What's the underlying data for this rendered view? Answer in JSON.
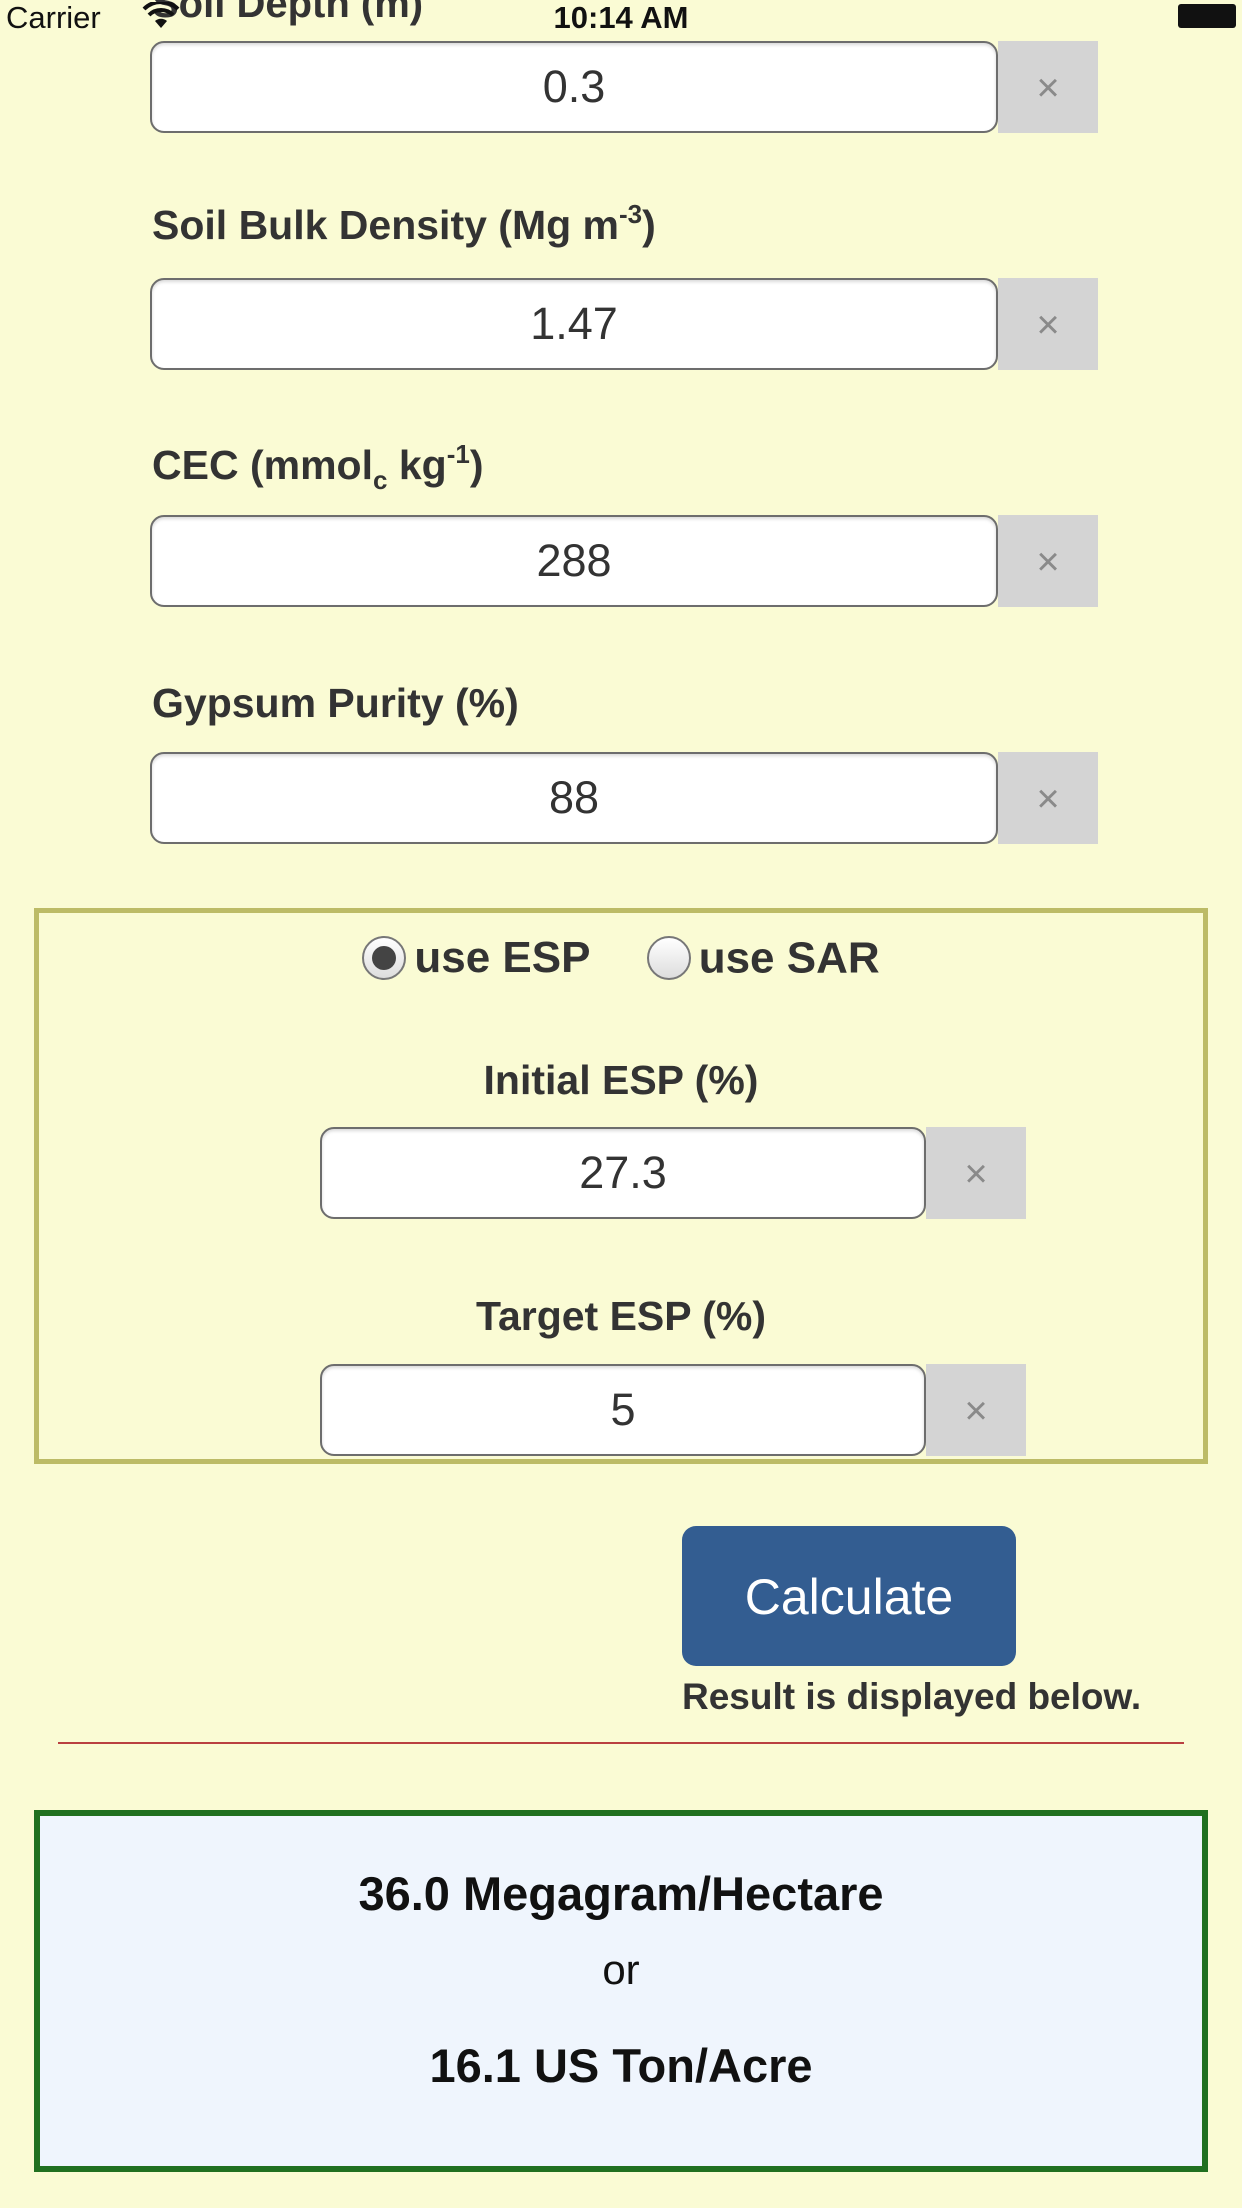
{
  "status_bar": {
    "carrier": "Carrier",
    "time": "10:14 AM"
  },
  "fields": {
    "soil_depth": {
      "label": "Soil Depth (m)",
      "value": "0.3",
      "clear_label": "×"
    },
    "bulk_density": {
      "label_main": "Soil Bulk Density (Mg m",
      "label_sup": "-3",
      "label_end": ")",
      "value": "1.47",
      "clear_label": "×"
    },
    "cec": {
      "label_main": "CEC (mmol",
      "label_sub": "c",
      "label_mid": " kg",
      "label_sup": "-1",
      "label_end": ")",
      "value": "288",
      "clear_label": "×"
    },
    "gypsum_purity": {
      "label": "Gypsum Purity (%)",
      "value": "88",
      "clear_label": "×"
    }
  },
  "mode": {
    "options": [
      {
        "label": "use ESP",
        "selected": true
      },
      {
        "label": "use SAR",
        "selected": false
      }
    ],
    "initial_esp": {
      "label": "Initial ESP (%)",
      "value": "27.3",
      "clear_label": "×"
    },
    "target_esp": {
      "label": "Target ESP (%)",
      "value": "5",
      "clear_label": "×"
    }
  },
  "calculate": {
    "label": "Calculate",
    "note": "Result is displayed below."
  },
  "result": {
    "primary": "36.0 Megagram/Hectare",
    "or": "or",
    "secondary": "16.1 US Ton/Acre"
  },
  "colors": {
    "background": "#fafbd4",
    "button": "#335d91",
    "mode_border": "#bcbb66",
    "result_border": "#207020",
    "result_bg": "#eff5fd",
    "divider": "#b94040"
  },
  "icons": {
    "status_wifi": "wifi-icon",
    "status_battery": "battery-icon",
    "clear": "close-icon"
  }
}
